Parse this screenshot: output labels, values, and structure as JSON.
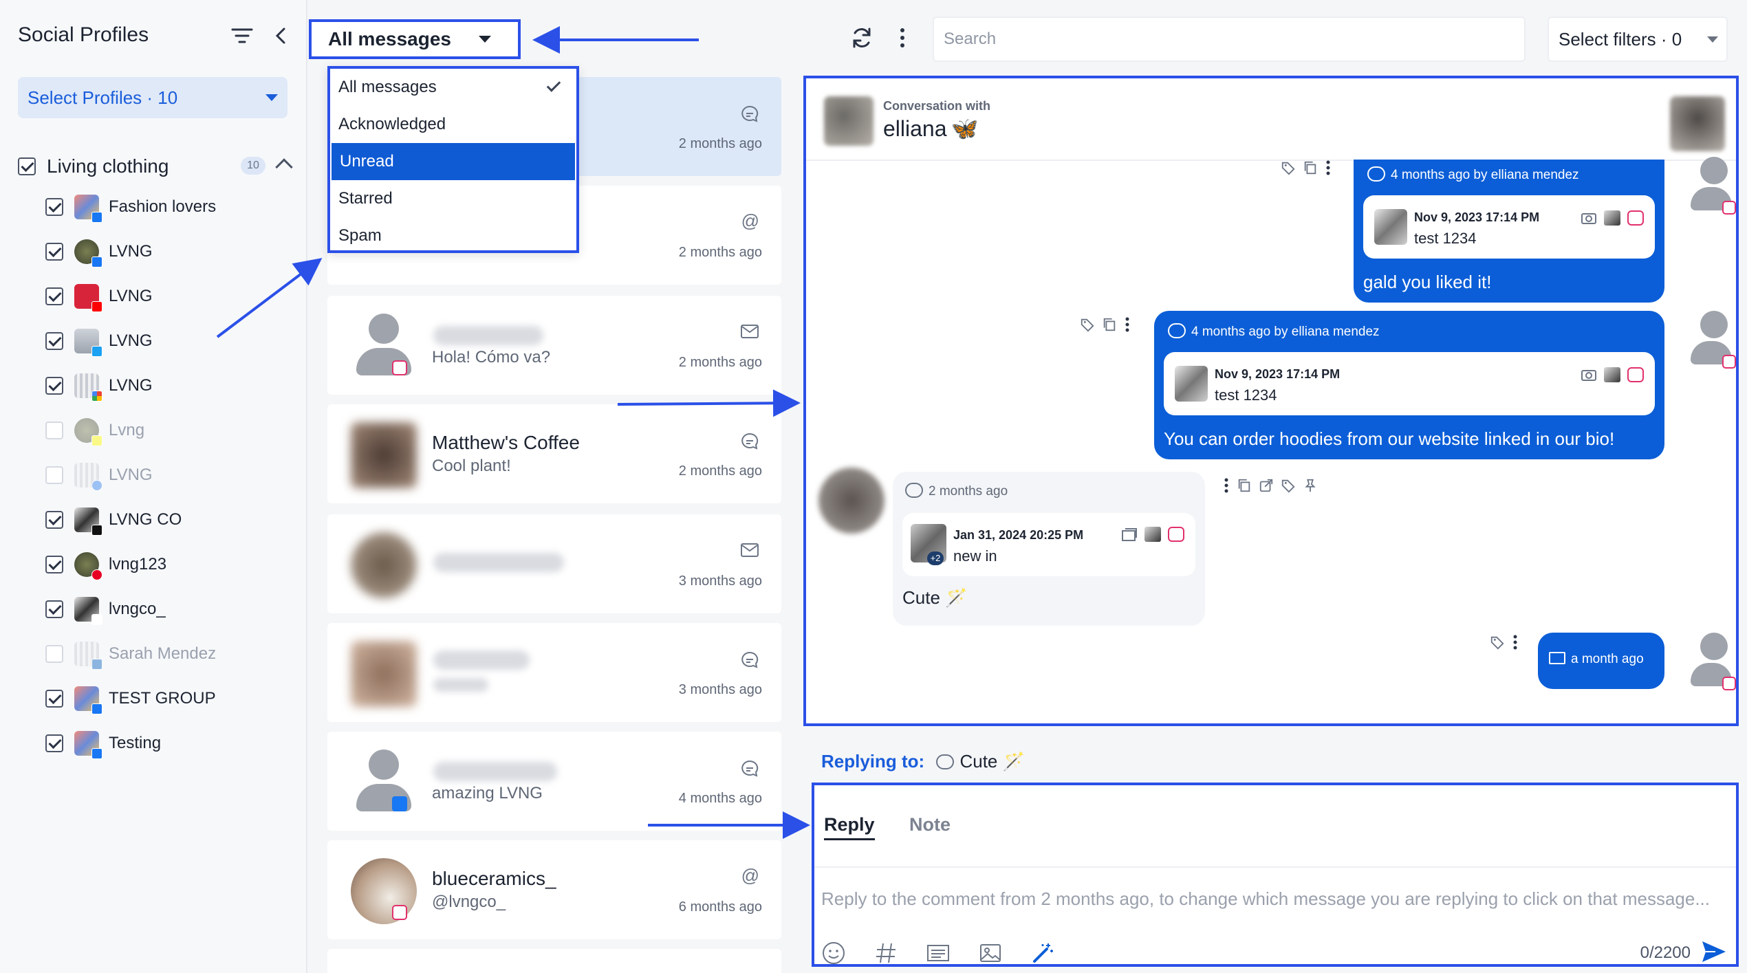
{
  "sidebar": {
    "title": "Social Profiles",
    "select_profiles": "Select Profiles · 10",
    "group": {
      "label": "Living clothing",
      "count": "10"
    },
    "profiles": [
      {
        "label": "Fashion lovers",
        "checked": true,
        "network": "facebook"
      },
      {
        "label": "LVNG",
        "checked": true,
        "network": "facebook"
      },
      {
        "label": "LVNG",
        "checked": true,
        "network": "youtube"
      },
      {
        "label": "LVNG",
        "checked": true,
        "network": "twitter"
      },
      {
        "label": "LVNG",
        "checked": true,
        "network": "google"
      },
      {
        "label": "Lvng",
        "checked": false,
        "network": "snapchat"
      },
      {
        "label": "LVNG",
        "checked": false,
        "network": "other"
      },
      {
        "label": "LVNG CO",
        "checked": true,
        "network": "tiktok"
      },
      {
        "label": "lvng123",
        "checked": true,
        "network": "pinterest"
      },
      {
        "label": "lvngco_",
        "checked": true,
        "network": "instagram"
      },
      {
        "label": "Sarah Mendez",
        "checked": false,
        "network": "linkedin"
      },
      {
        "label": "TEST GROUP",
        "checked": true,
        "network": "facebook"
      },
      {
        "label": "Testing",
        "checked": true,
        "network": "facebook"
      }
    ]
  },
  "toolbar": {
    "message_filter": "All messages",
    "search_placeholder": "Search",
    "select_filters": "Select filters · 0"
  },
  "dropdown": {
    "options": [
      "All messages",
      "Acknowledged",
      "Unread",
      "Starred",
      "Spam"
    ],
    "selected": "All messages",
    "highlighted": "Unread"
  },
  "messages": [
    {
      "name": "",
      "preview": "",
      "time": "2 months ago",
      "kind": "comment-icon"
    },
    {
      "name": "",
      "preview": "",
      "time": "2 months ago",
      "kind": "mention-icon"
    },
    {
      "name": "",
      "preview": "Hola! Cómo va?",
      "time": "2 months ago",
      "kind": "mail-icon"
    },
    {
      "name": "Matthew's Coffee",
      "preview": "Cool plant!",
      "time": "2 months ago",
      "kind": "comment-icon"
    },
    {
      "name": "",
      "preview": "",
      "time": "3 months ago",
      "kind": "mail-icon"
    },
    {
      "name": "",
      "preview": "",
      "time": "3 months ago",
      "kind": "comment-icon"
    },
    {
      "name": "",
      "preview": "amazing LVNG",
      "time": "4 months ago",
      "kind": "comment-icon"
    },
    {
      "name": "blueceramics_",
      "preview": "@lvngco_",
      "time": "6 months ago",
      "kind": "mention-icon"
    }
  ],
  "conversation": {
    "subtitle": "Conversation with",
    "name": "elliana",
    "name_emoji": "🦋",
    "bubbles": [
      {
        "meta": "4 months ago  by elliana mendez",
        "post_date": "Nov 9, 2023 17:14 PM",
        "post_text": "test 1234",
        "message": "gald you liked it!"
      },
      {
        "meta": "4 months ago  by elliana mendez",
        "post_date": "Nov 9, 2023 17:14 PM",
        "post_text": "test 1234",
        "message": "You can order hoodies from our website linked in our bio!"
      }
    ],
    "incoming": {
      "meta": "2 months ago",
      "post_date": "Jan 31, 2024 20:25 PM",
      "post_text": "new in",
      "extra_count": "+2",
      "message": "Cute 🪄"
    },
    "last": {
      "meta": "a month ago"
    }
  },
  "reply": {
    "replying_to_label": "Replying to:",
    "replying_to_text": "Cute 🪄",
    "tab_reply": "Reply",
    "tab_note": "Note",
    "placeholder": "Reply to the comment from 2 months ago, to change which message you are replying to click on that message...",
    "counter": "0/2200"
  },
  "colors": {
    "accent": "#0b5ed7",
    "annotation": "#2b50e8",
    "active_card": "#dce8f8"
  }
}
